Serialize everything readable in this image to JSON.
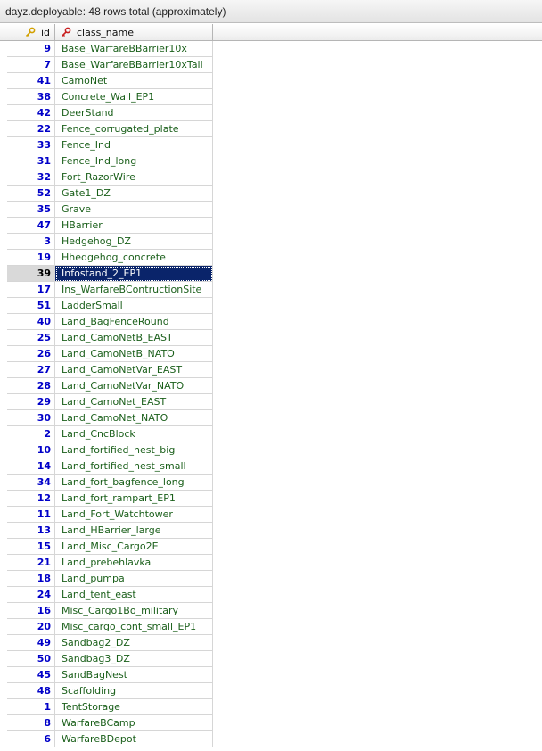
{
  "title": "dayz.deployable: 48 rows total (approximately)",
  "columns": {
    "id": "id",
    "class_name": "class_name"
  },
  "selected_index": 15,
  "colors": {
    "id_text": "#0000c8",
    "class_text": "#1a5f1a",
    "selection": "#0a246a"
  },
  "rows": [
    {
      "id": "9",
      "class_name": "Base_WarfareBBarrier10x"
    },
    {
      "id": "7",
      "class_name": "Base_WarfareBBarrier10xTall"
    },
    {
      "id": "41",
      "class_name": "CamoNet"
    },
    {
      "id": "38",
      "class_name": "Concrete_Wall_EP1"
    },
    {
      "id": "42",
      "class_name": "DeerStand"
    },
    {
      "id": "22",
      "class_name": "Fence_corrugated_plate"
    },
    {
      "id": "33",
      "class_name": "Fence_Ind"
    },
    {
      "id": "31",
      "class_name": "Fence_Ind_long"
    },
    {
      "id": "32",
      "class_name": "Fort_RazorWire"
    },
    {
      "id": "52",
      "class_name": "Gate1_DZ"
    },
    {
      "id": "35",
      "class_name": "Grave"
    },
    {
      "id": "47",
      "class_name": "HBarrier"
    },
    {
      "id": "3",
      "class_name": "Hedgehog_DZ"
    },
    {
      "id": "19",
      "class_name": "Hhedgehog_concrete"
    },
    {
      "id": "39",
      "class_name": "Infostand_2_EP1"
    },
    {
      "id": "17",
      "class_name": "Ins_WarfareBContructionSite"
    },
    {
      "id": "51",
      "class_name": "LadderSmall"
    },
    {
      "id": "40",
      "class_name": "Land_BagFenceRound"
    },
    {
      "id": "25",
      "class_name": "Land_CamoNetB_EAST"
    },
    {
      "id": "26",
      "class_name": "Land_CamoNetB_NATO"
    },
    {
      "id": "27",
      "class_name": "Land_CamoNetVar_EAST"
    },
    {
      "id": "28",
      "class_name": "Land_CamoNetVar_NATO"
    },
    {
      "id": "29",
      "class_name": "Land_CamoNet_EAST"
    },
    {
      "id": "30",
      "class_name": "Land_CamoNet_NATO"
    },
    {
      "id": "2",
      "class_name": "Land_CncBlock"
    },
    {
      "id": "10",
      "class_name": "Land_fortified_nest_big"
    },
    {
      "id": "14",
      "class_name": "Land_fortified_nest_small"
    },
    {
      "id": "34",
      "class_name": "Land_fort_bagfence_long"
    },
    {
      "id": "12",
      "class_name": "Land_fort_rampart_EP1"
    },
    {
      "id": "11",
      "class_name": "Land_Fort_Watchtower"
    },
    {
      "id": "13",
      "class_name": "Land_HBarrier_large"
    },
    {
      "id": "15",
      "class_name": "Land_Misc_Cargo2E"
    },
    {
      "id": "21",
      "class_name": "Land_prebehlavka"
    },
    {
      "id": "18",
      "class_name": "Land_pumpa"
    },
    {
      "id": "24",
      "class_name": "Land_tent_east"
    },
    {
      "id": "16",
      "class_name": "Misc_Cargo1Bo_military"
    },
    {
      "id": "20",
      "class_name": "Misc_cargo_cont_small_EP1"
    },
    {
      "id": "49",
      "class_name": "Sandbag2_DZ"
    },
    {
      "id": "50",
      "class_name": "Sandbag3_DZ"
    },
    {
      "id": "45",
      "class_name": "SandBagNest"
    },
    {
      "id": "48",
      "class_name": "Scaffolding"
    },
    {
      "id": "1",
      "class_name": "TentStorage"
    },
    {
      "id": "8",
      "class_name": "WarfareBCamp"
    },
    {
      "id": "6",
      "class_name": "WarfareBDepot"
    }
  ]
}
